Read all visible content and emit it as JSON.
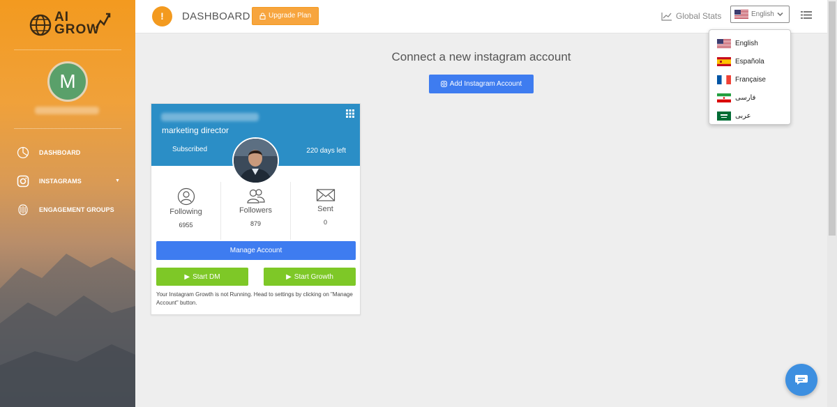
{
  "brand": {
    "line1": "AI",
    "line2": "GROW"
  },
  "user": {
    "initial": "M"
  },
  "sidebar": {
    "items": [
      {
        "label": "DASHBOARD",
        "icon": "pie-chart-icon"
      },
      {
        "label": "INSTAGRAMS",
        "icon": "instagram-icon",
        "has_caret": true
      },
      {
        "label": "ENGAGEMENT GROUPS",
        "icon": "engagement-icon"
      }
    ]
  },
  "topbar": {
    "menu_symbol": "!",
    "title": "DASHBOARD",
    "upgrade_label": "Upgrade Plan",
    "global_stats_label": "Global Stats",
    "language_selected": "English"
  },
  "language_menu": {
    "items": [
      {
        "label": "English",
        "flag": "us-flag"
      },
      {
        "label": "Española",
        "flag": "es-flag"
      },
      {
        "label": "Française",
        "flag": "fr-flag"
      },
      {
        "label": "فارسی",
        "flag": "ir-flag"
      },
      {
        "label": "عربی",
        "flag": "sa-flag"
      }
    ]
  },
  "main": {
    "connect_title": "Connect a new instagram account",
    "add_button_label": "Add Instagram Account"
  },
  "account_card": {
    "role": "marketing director",
    "subscription_status": "Subscribed",
    "days_left": "220 days left",
    "stats": [
      {
        "label": "Following",
        "value": "6955",
        "icon": "user-icon"
      },
      {
        "label": "Followers",
        "value": "879",
        "icon": "users-icon"
      },
      {
        "label": "Sent",
        "value": "0",
        "icon": "envelope-icon"
      }
    ],
    "manage_label": "Manage Account",
    "start_dm_label": "Start DM",
    "start_growth_label": "Start Growth",
    "notice": "Your Instagram Growth is not Running. Head to settings by clicking on \"Manage Account\" button."
  },
  "colors": {
    "accent_orange": "#f39a1f",
    "primary_blue": "#3e7cf0",
    "card_header_blue": "#2b8ec6",
    "success_green": "#7ec827"
  }
}
